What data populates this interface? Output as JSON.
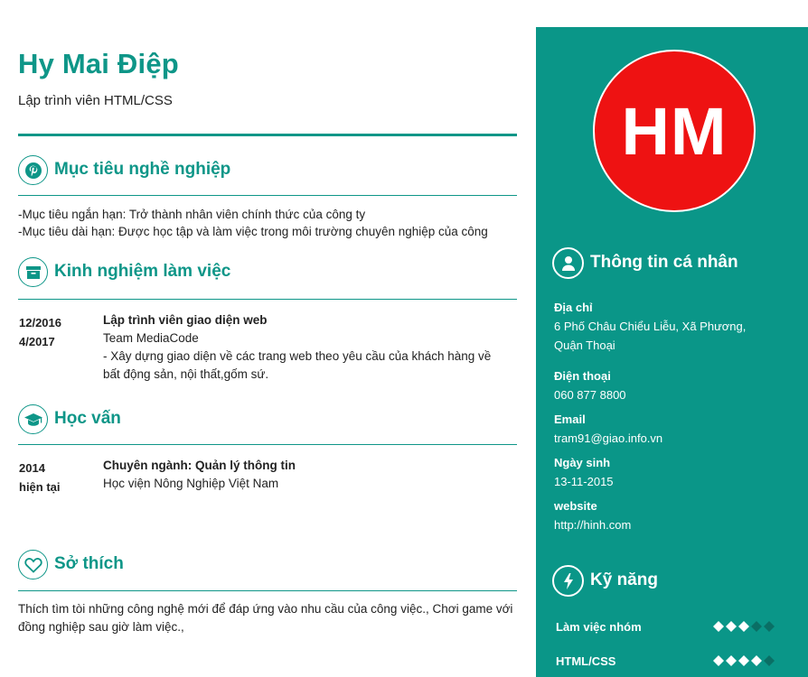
{
  "header": {
    "name": "Hy Mai Điệp",
    "role": "Lập trình viên HTML/CSS"
  },
  "objective": {
    "title": "Mục tiêu nghề nghiệp",
    "icon": "pinterest-icon",
    "lines": [
      "-Mục tiêu ngắn hạn: Trở thành nhân viên chính thức của công ty",
      "-Mục tiêu dài hạn: Được học tập và làm việc trong môi trường chuyên nghiệp của công"
    ]
  },
  "experience": {
    "title": "Kinh nghiệm làm việc",
    "icon": "archive-icon",
    "items": [
      {
        "date_start": "12/2016",
        "date_end": "4/2017",
        "position": "Lập trình viên giao diện web",
        "company": "Team MediaCode",
        "description": "- Xây dựng giao diện về các trang web theo yêu cầu của khách hàng về bất động sản, nội thất,gốm sứ."
      }
    ]
  },
  "education": {
    "title": "Học vấn",
    "icon": "graduation-cap-icon",
    "items": [
      {
        "date_start": "2014",
        "date_end": "hiện tại",
        "major": "Chuyên ngành: Quản lý thông tin",
        "school": "Học viện Nông Nghiệp Việt Nam"
      }
    ]
  },
  "hobbies": {
    "title": "Sở thích",
    "icon": "heart-icon",
    "text": "Thích tìm tòi những công nghệ mới để đáp ứng vào nhu cầu của công việc., Chơi game với đồng nghiệp sau giờ làm việc.,"
  },
  "sidebar": {
    "avatar_initials": "HM",
    "avatar_color": "#ee1212",
    "accent_color": "#0a9688",
    "personal": {
      "title": "Thông tin cá nhân",
      "icon": "user-icon",
      "address_label": "Địa chỉ",
      "address_value": "6 Phố Châu Chiểu Liễu, Xã Phương, Quận Thoại",
      "phone_label": "Điện thoại",
      "phone_value": "060 877 8800",
      "email_label": "Email",
      "email_value": "tram91@giao.info.vn",
      "birthday_label": "Ngày sinh",
      "birthday_value": "13-11-2015",
      "website_label": "website",
      "website_value": "http://hinh.com"
    },
    "skills": {
      "title": "Kỹ năng",
      "icon": "bolt-icon",
      "items": [
        {
          "label": "Làm việc nhóm",
          "level": 3,
          "max": 5
        },
        {
          "label": "HTML/CSS",
          "level": 4,
          "max": 5
        }
      ]
    }
  }
}
